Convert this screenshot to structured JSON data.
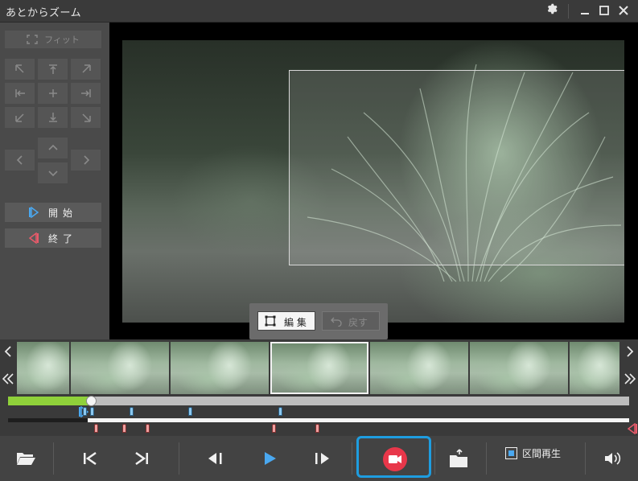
{
  "app": {
    "title": "あとからズーム"
  },
  "titlebar": {
    "settings_icon": "gear-icon",
    "minimize_icon": "minimize-icon",
    "maximize_icon": "maximize-icon",
    "close_icon": "close-icon"
  },
  "left_panel": {
    "fit_label": "フィット",
    "start_label": "開始",
    "end_label": "終了",
    "position_buttons": [
      "align-top-left-icon",
      "align-top-icon",
      "align-top-right-icon",
      "align-left-icon",
      "center-plus-icon",
      "align-right-icon",
      "align-bottom-left-icon",
      "align-bottom-icon",
      "align-bottom-right-icon"
    ],
    "nudge_buttons": [
      "chevron-up-icon",
      "chevron-left-icon",
      "chevron-right-icon",
      "chevron-down-icon"
    ]
  },
  "edit_toolbar": {
    "edit_label": "編 集",
    "undo_label": "戻す"
  },
  "filmstrip": {
    "thumbnail_count": 7,
    "selected_index": 3
  },
  "timeline": {
    "play_range_fraction": 0.134,
    "zoom_range_start_fraction": 0.128,
    "blue_markers": [
      0.121,
      0.132,
      0.195,
      0.29,
      0.435
    ],
    "red_markers": [
      0.138,
      0.184,
      0.222,
      0.425,
      0.495
    ]
  },
  "bottom_bar": {
    "open_icon": "folder-open-icon",
    "skip_start_icon": "skip-to-start-icon",
    "skip_end_icon": "skip-to-end-icon",
    "prev_frame_icon": "previous-frame-icon",
    "play_icon": "play-icon",
    "next_frame_icon": "next-frame-icon",
    "record_icon": "video-camera-icon",
    "export_icon": "folder-export-icon",
    "interval_play_label": "区間再生",
    "interval_play_checked": true,
    "volume_icon": "volume-icon"
  },
  "colors": {
    "accent_blue": "#1e9de0",
    "record_red": "#e8374a",
    "range_green": "#8fd13a",
    "play_blue": "#4aa8f0"
  }
}
